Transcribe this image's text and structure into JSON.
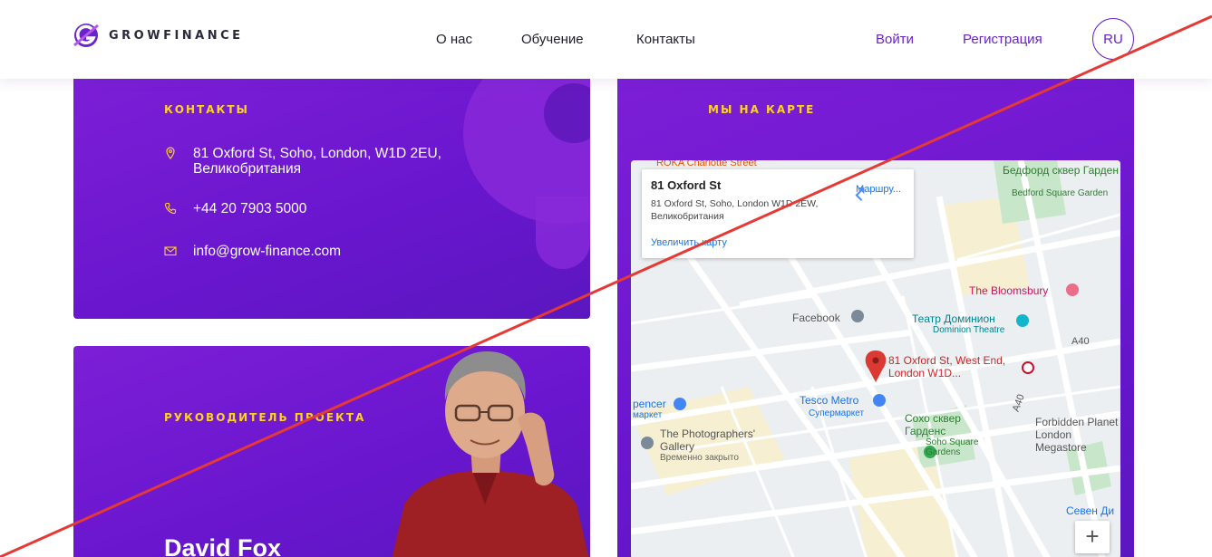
{
  "header": {
    "logo_text": "GROWFINANCE",
    "nav": [
      "О нас",
      "Обучение",
      "Контакты"
    ],
    "login": "Войти",
    "register": "Регистрация",
    "lang": "RU"
  },
  "contacts": {
    "heading": "КОНТАКТЫ",
    "address_line1": "81 Oxford St, Soho, London, W1D 2EU,",
    "address_line2": "Великобритания",
    "phone": "+44 20 7903 5000",
    "email": "info@grow-finance.com"
  },
  "leader": {
    "heading": "РУКОВОДИТЕЛЬ ПРОЕКТА",
    "name": "David Fox"
  },
  "map_section": {
    "heading": "МЫ НА КАРТЕ",
    "info": {
      "title": "81 Oxford St",
      "address": "81 Oxford St, Soho, London W1D 2EW, Великобритания",
      "enlarge": "Увеличить карту",
      "route": "Маршру..."
    },
    "labels": {
      "bedford": "Бедфорд сквер Гарден",
      "bedford_en": "Bedford Square Garden",
      "bloomsbury": "The Bloomsbury",
      "facebook": "Facebook",
      "theatre": "Театр Доминион",
      "theatre_en": "Dominion Theatre",
      "pin": "81 Oxford St, West End, London W1D...",
      "tesco": "Tesco Metro",
      "tesco_sub": "Супермаркет",
      "soho": "Сохо сквер Гарденс",
      "soho_en": "Soho Square Gardens",
      "photographers": "The Photographers' Gallery",
      "photographers_sub": "Временно закрыто",
      "forbidden": "Forbidden Planet London Megastore",
      "spencer": "pencer",
      "spencer_sub": "маркет",
      "seven": "Севен Ди",
      "a40": "A40",
      "a40b": "A40",
      "charlotte": "ROKA Charlotte Street"
    },
    "zoom_in": "+"
  },
  "colors": {
    "purple": "#6a16cf",
    "yellow": "#ffd21f",
    "accent": "#6a22c9",
    "strike": "#e53935"
  }
}
